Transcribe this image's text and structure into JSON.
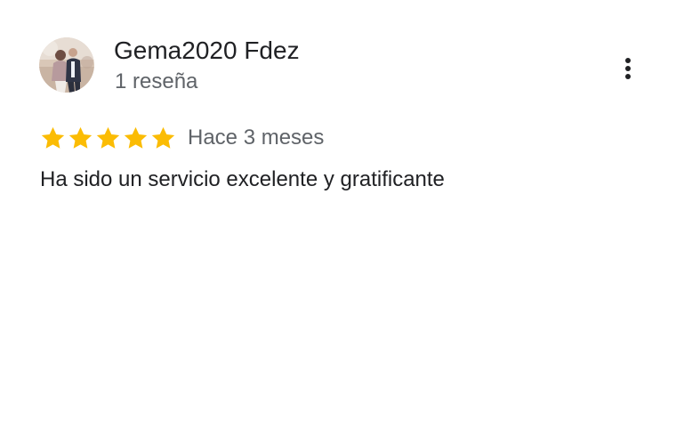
{
  "review": {
    "reviewer_name": "Gema2020 Fdez",
    "review_count": "1 reseña",
    "rating": 5,
    "rating_max": 5,
    "time": "Hace 3 meses",
    "text": "Ha sido un servicio excelente y gratificante",
    "star_color": "#fbbc04",
    "avatar_icon": "user-photo-avatar",
    "more_icon": "more-vert-icon"
  }
}
